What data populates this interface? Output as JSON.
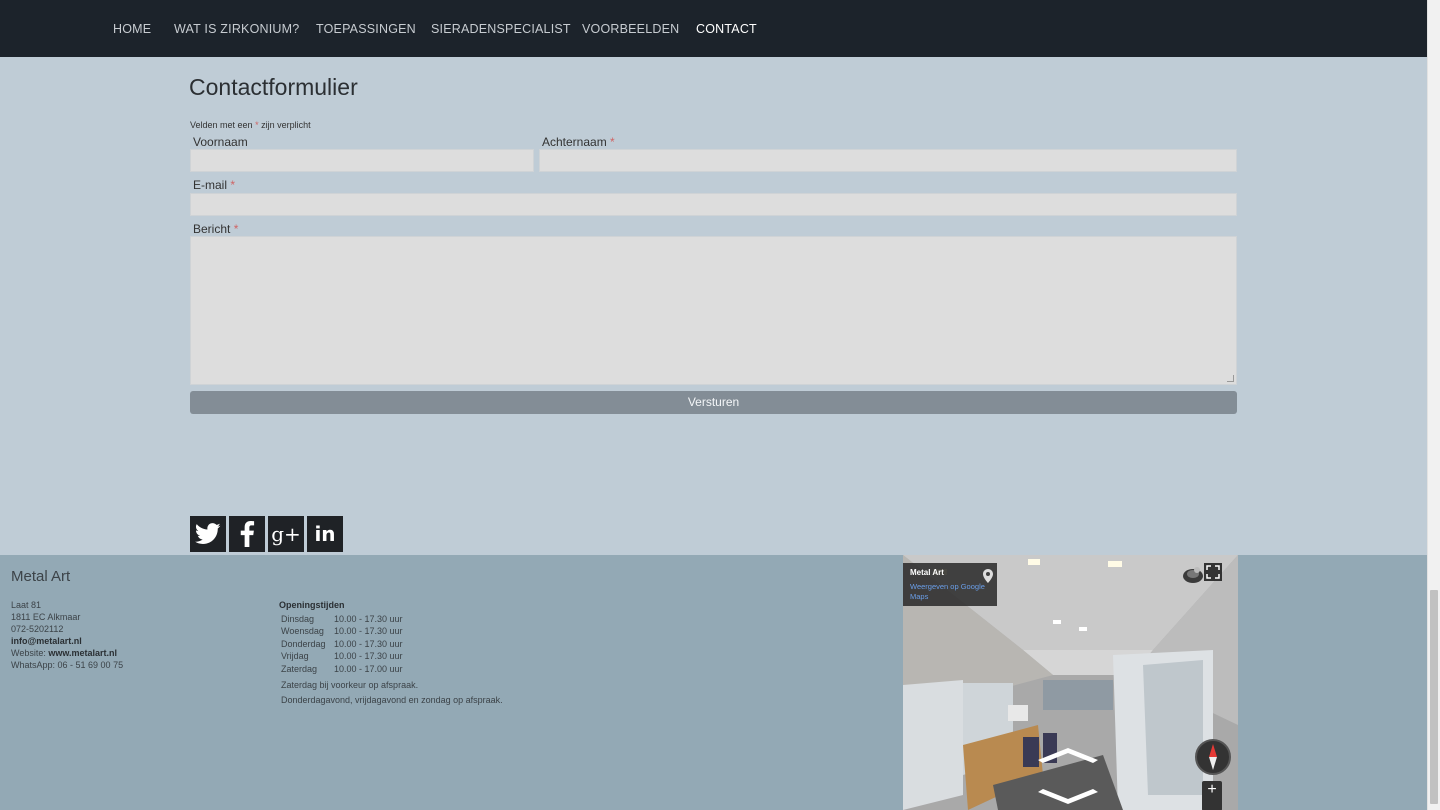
{
  "nav": {
    "items": [
      "HOME",
      "WAT IS ZIRKONIUM?",
      "TOEPASSINGEN",
      "SIERADENSPECIALIST",
      "VOORBEELDEN",
      "CONTACT"
    ],
    "active": "CONTACT"
  },
  "form": {
    "title": "Contactformulier",
    "note_prefix": "Velden met een",
    "note_star": "*",
    "note_suffix": "zijn verplicht",
    "first_name_label": "Voornaam",
    "last_name_label": "Achternaam",
    "email_label": "E-mail",
    "message_label": "Bericht",
    "required_mark": "*",
    "submit_label": "Versturen"
  },
  "social": {
    "icons": [
      "twitter-icon",
      "facebook-icon",
      "google-plus-icon",
      "linkedin-icon"
    ],
    "google_plus_glyph": "g+",
    "linkedin_glyph": "in"
  },
  "footer": {
    "company": "Metal Art",
    "street": "Laat 81",
    "postal": "1811 EC  Alkmaar",
    "phone": "072-5202112",
    "email": "info@metalart.nl",
    "website_label": "Website:",
    "website": "www.metalart.nl",
    "whatsapp": "WhatsApp: 06 - 51 69 00 75",
    "hours_title": "Openingstijden",
    "hours": [
      {
        "day": "Dinsdag",
        "time": "10.00 - 17.30 uur"
      },
      {
        "day": "Woensdag",
        "time": "10.00 - 17.30 uur"
      },
      {
        "day": "Donderdag",
        "time": "10.00 - 17.30 uur"
      },
      {
        "day": "Vrijdag",
        "time": "10.00 - 17.30 uur"
      },
      {
        "day": "Zaterdag",
        "time": "10.00 - 17.00 uur"
      }
    ],
    "note1": "Zaterdag bij voorkeur op afspraak.",
    "note2": "Donderdagavond, vrijdagavond en zondag op afspraak."
  },
  "streetview": {
    "place_name": "Metal Art",
    "link_text": "Weergeven op Google Maps",
    "zoom_in": "+"
  }
}
